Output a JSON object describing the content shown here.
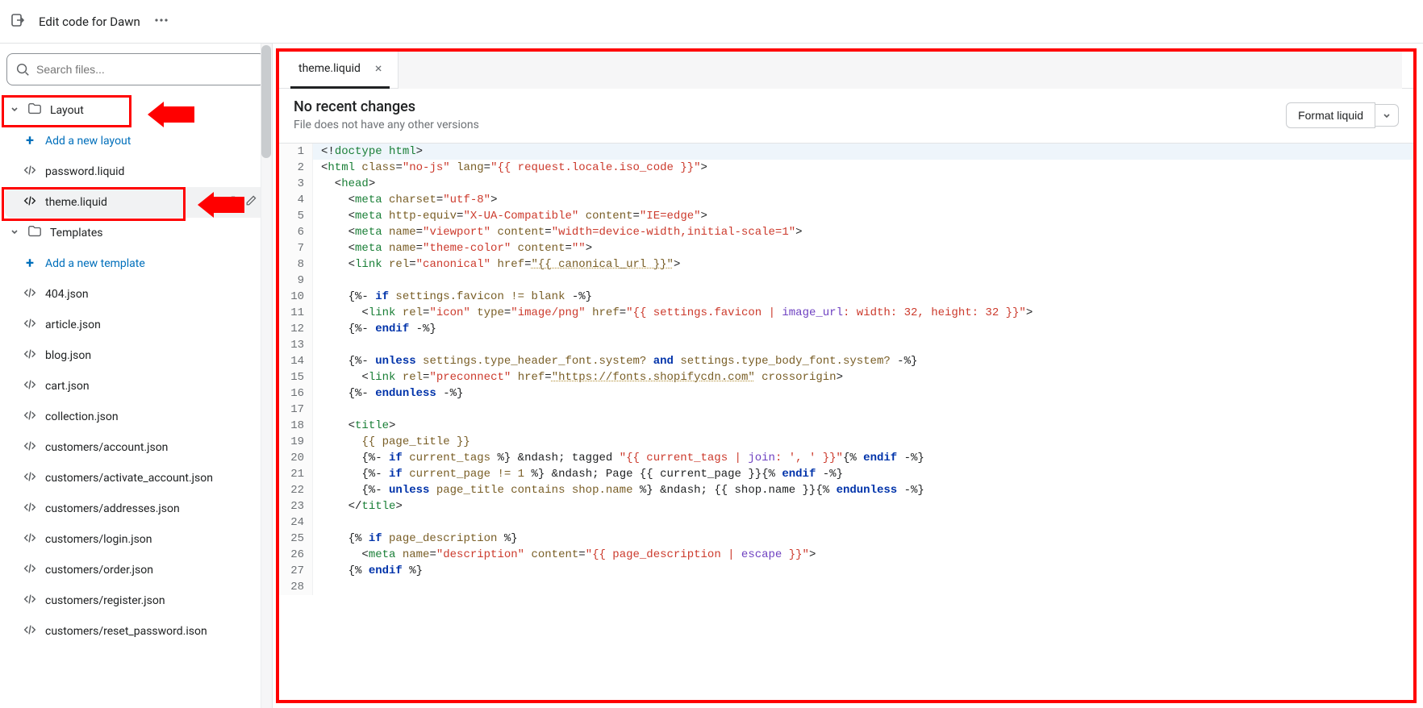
{
  "topbar": {
    "title": "Edit code for Dawn"
  },
  "sidebar": {
    "search_placeholder": "Search files...",
    "layout_folder": "Layout",
    "add_layout": "Add a new layout",
    "files_layout": [
      "password.liquid",
      "theme.liquid"
    ],
    "templates_folder": "Templates",
    "add_template": "Add a new template",
    "files_templates": [
      "404.json",
      "article.json",
      "blog.json",
      "cart.json",
      "collection.json",
      "customers/account.json",
      "customers/activate_account.json",
      "customers/addresses.json",
      "customers/login.json",
      "customers/order.json",
      "customers/register.json",
      "customers/reset_password.ison"
    ]
  },
  "editor": {
    "tab_name": "theme.liquid",
    "header_title": "No recent changes",
    "header_sub": "File does not have any other versions",
    "format_btn": "Format liquid"
  },
  "code_lines": [
    {
      "n": 1,
      "hl": true,
      "seg": [
        [
          "t-punc",
          "<!"
        ],
        [
          "t-tag",
          "doctype"
        ],
        [
          "t-punc",
          " "
        ],
        [
          "t-tag",
          "html"
        ],
        [
          "t-punc",
          ">"
        ]
      ]
    },
    {
      "n": 2,
      "seg": [
        [
          "t-punc",
          "<"
        ],
        [
          "t-tag",
          "html"
        ],
        [
          "t-punc",
          " "
        ],
        [
          "t-attr",
          "class"
        ],
        [
          "t-punc",
          "="
        ],
        [
          "t-str",
          "\"no-js\""
        ],
        [
          "t-punc",
          " "
        ],
        [
          "t-attr",
          "lang"
        ],
        [
          "t-punc",
          "="
        ],
        [
          "t-str",
          "\"{{ request.locale.iso_code }}\""
        ],
        [
          "t-punc",
          ">"
        ]
      ]
    },
    {
      "n": 3,
      "seg": [
        [
          "t-punc",
          "  <"
        ],
        [
          "t-tag",
          "head"
        ],
        [
          "t-punc",
          ">"
        ]
      ]
    },
    {
      "n": 4,
      "seg": [
        [
          "t-punc",
          "    <"
        ],
        [
          "t-tag",
          "meta"
        ],
        [
          "t-punc",
          " "
        ],
        [
          "t-attr",
          "charset"
        ],
        [
          "t-punc",
          "="
        ],
        [
          "t-str",
          "\"utf-8\""
        ],
        [
          "t-punc",
          ">"
        ]
      ]
    },
    {
      "n": 5,
      "seg": [
        [
          "t-punc",
          "    <"
        ],
        [
          "t-tag",
          "meta"
        ],
        [
          "t-punc",
          " "
        ],
        [
          "t-attr",
          "http-equiv"
        ],
        [
          "t-punc",
          "="
        ],
        [
          "t-str",
          "\"X-UA-Compatible\""
        ],
        [
          "t-punc",
          " "
        ],
        [
          "t-attr",
          "content"
        ],
        [
          "t-punc",
          "="
        ],
        [
          "t-str",
          "\"IE=edge\""
        ],
        [
          "t-punc",
          ">"
        ]
      ]
    },
    {
      "n": 6,
      "seg": [
        [
          "t-punc",
          "    <"
        ],
        [
          "t-tag",
          "meta"
        ],
        [
          "t-punc",
          " "
        ],
        [
          "t-attr",
          "name"
        ],
        [
          "t-punc",
          "="
        ],
        [
          "t-str",
          "\"viewport\""
        ],
        [
          "t-punc",
          " "
        ],
        [
          "t-attr",
          "content"
        ],
        [
          "t-punc",
          "="
        ],
        [
          "t-str",
          "\"width=device-width,initial-scale=1\""
        ],
        [
          "t-punc",
          ">"
        ]
      ]
    },
    {
      "n": 7,
      "seg": [
        [
          "t-punc",
          "    <"
        ],
        [
          "t-tag",
          "meta"
        ],
        [
          "t-punc",
          " "
        ],
        [
          "t-attr",
          "name"
        ],
        [
          "t-punc",
          "="
        ],
        [
          "t-str",
          "\"theme-color\""
        ],
        [
          "t-punc",
          " "
        ],
        [
          "t-attr",
          "content"
        ],
        [
          "t-punc",
          "="
        ],
        [
          "t-str",
          "\"\""
        ],
        [
          "t-punc",
          ">"
        ]
      ]
    },
    {
      "n": 8,
      "seg": [
        [
          "t-punc",
          "    <"
        ],
        [
          "t-tag",
          "link"
        ],
        [
          "t-punc",
          " "
        ],
        [
          "t-attr",
          "rel"
        ],
        [
          "t-punc",
          "="
        ],
        [
          "t-str",
          "\"canonical\""
        ],
        [
          "t-punc",
          " "
        ],
        [
          "t-attr",
          "href"
        ],
        [
          "t-punc",
          "="
        ],
        [
          "t-url",
          "\"{{ canonical_url }}\""
        ],
        [
          "t-punc",
          ">"
        ]
      ]
    },
    {
      "n": 9,
      "seg": [
        [
          "",
          ""
        ]
      ]
    },
    {
      "n": 10,
      "seg": [
        [
          "t-punc",
          "    {%- "
        ],
        [
          "t-kw",
          "if"
        ],
        [
          "t-liq",
          " settings.favicon != blank "
        ],
        [
          "t-punc",
          "-%}"
        ]
      ]
    },
    {
      "n": 11,
      "seg": [
        [
          "t-punc",
          "      <"
        ],
        [
          "t-tag",
          "link"
        ],
        [
          "t-punc",
          " "
        ],
        [
          "t-attr",
          "rel"
        ],
        [
          "t-punc",
          "="
        ],
        [
          "t-str",
          "\"icon\""
        ],
        [
          "t-punc",
          " "
        ],
        [
          "t-attr",
          "type"
        ],
        [
          "t-punc",
          "="
        ],
        [
          "t-str",
          "\"image/png\""
        ],
        [
          "t-punc",
          " "
        ],
        [
          "t-attr",
          "href"
        ],
        [
          "t-punc",
          "="
        ],
        [
          "t-str",
          "\"{{ settings.favicon | "
        ],
        [
          "t-filter",
          "image_url"
        ],
        [
          "t-str",
          ": width: 32, height: 32 }}\""
        ],
        [
          "t-punc",
          ">"
        ]
      ]
    },
    {
      "n": 12,
      "seg": [
        [
          "t-punc",
          "    {%- "
        ],
        [
          "t-kw",
          "endif"
        ],
        [
          "t-punc",
          " -%}"
        ]
      ]
    },
    {
      "n": 13,
      "seg": [
        [
          "",
          ""
        ]
      ]
    },
    {
      "n": 14,
      "seg": [
        [
          "t-punc",
          "    {%- "
        ],
        [
          "t-kw",
          "unless"
        ],
        [
          "t-liq",
          " settings.type_header_font.system? "
        ],
        [
          "t-kw",
          "and"
        ],
        [
          "t-liq",
          " settings.type_body_font.system? "
        ],
        [
          "t-punc",
          "-%}"
        ]
      ]
    },
    {
      "n": 15,
      "seg": [
        [
          "t-punc",
          "      <"
        ],
        [
          "t-tag",
          "link"
        ],
        [
          "t-punc",
          " "
        ],
        [
          "t-attr",
          "rel"
        ],
        [
          "t-punc",
          "="
        ],
        [
          "t-str",
          "\"preconnect\""
        ],
        [
          "t-punc",
          " "
        ],
        [
          "t-attr",
          "href"
        ],
        [
          "t-punc",
          "="
        ],
        [
          "t-url",
          "\"https://fonts.shopifycdn.com\""
        ],
        [
          "t-punc",
          " "
        ],
        [
          "t-attr",
          "crossorigin"
        ],
        [
          "t-punc",
          ">"
        ]
      ]
    },
    {
      "n": 16,
      "seg": [
        [
          "t-punc",
          "    {%- "
        ],
        [
          "t-kw",
          "endunless"
        ],
        [
          "t-punc",
          " -%}"
        ]
      ]
    },
    {
      "n": 17,
      "seg": [
        [
          "",
          ""
        ]
      ]
    },
    {
      "n": 18,
      "seg": [
        [
          "t-punc",
          "    <"
        ],
        [
          "t-tag",
          "title"
        ],
        [
          "t-punc",
          ">"
        ]
      ]
    },
    {
      "n": 19,
      "seg": [
        [
          "t-liq",
          "      {{ page_title }}"
        ]
      ]
    },
    {
      "n": 20,
      "seg": [
        [
          "t-punc",
          "      {%- "
        ],
        [
          "t-kw",
          "if"
        ],
        [
          "t-liq",
          " current_tags "
        ],
        [
          "t-punc",
          "%}"
        ],
        [
          "t-var",
          " &ndash; tagged "
        ],
        [
          "t-str",
          "\"{{ current_tags | "
        ],
        [
          "t-filter",
          "join"
        ],
        [
          "t-str",
          ": ', ' }}\""
        ],
        [
          "t-punc",
          "{% "
        ],
        [
          "t-kw",
          "endif"
        ],
        [
          "t-punc",
          " -%}"
        ]
      ]
    },
    {
      "n": 21,
      "seg": [
        [
          "t-punc",
          "      {%- "
        ],
        [
          "t-kw",
          "if"
        ],
        [
          "t-liq",
          " current_page != 1 "
        ],
        [
          "t-punc",
          "%}"
        ],
        [
          "t-var",
          " &ndash; Page {{ current_page }}"
        ],
        [
          "t-punc",
          "{% "
        ],
        [
          "t-kw",
          "endif"
        ],
        [
          "t-punc",
          " -%}"
        ]
      ]
    },
    {
      "n": 22,
      "seg": [
        [
          "t-punc",
          "      {%- "
        ],
        [
          "t-kw",
          "unless"
        ],
        [
          "t-liq",
          " page_title contains shop.name "
        ],
        [
          "t-punc",
          "%}"
        ],
        [
          "t-var",
          " &ndash; {{ shop.name }}"
        ],
        [
          "t-punc",
          "{% "
        ],
        [
          "t-kw",
          "endunless"
        ],
        [
          "t-punc",
          " -%}"
        ]
      ]
    },
    {
      "n": 23,
      "seg": [
        [
          "t-punc",
          "    </"
        ],
        [
          "t-tag",
          "title"
        ],
        [
          "t-punc",
          ">"
        ]
      ]
    },
    {
      "n": 24,
      "seg": [
        [
          "",
          ""
        ]
      ]
    },
    {
      "n": 25,
      "seg": [
        [
          "t-punc",
          "    {% "
        ],
        [
          "t-kw",
          "if"
        ],
        [
          "t-liq",
          " page_description "
        ],
        [
          "t-punc",
          "%}"
        ]
      ]
    },
    {
      "n": 26,
      "seg": [
        [
          "t-punc",
          "      <"
        ],
        [
          "t-tag",
          "meta"
        ],
        [
          "t-punc",
          " "
        ],
        [
          "t-attr",
          "name"
        ],
        [
          "t-punc",
          "="
        ],
        [
          "t-str",
          "\"description\""
        ],
        [
          "t-punc",
          " "
        ],
        [
          "t-attr",
          "content"
        ],
        [
          "t-punc",
          "="
        ],
        [
          "t-str",
          "\"{{ page_description | "
        ],
        [
          "t-filter",
          "escape"
        ],
        [
          "t-str",
          " }}\""
        ],
        [
          "t-punc",
          ">"
        ]
      ]
    },
    {
      "n": 27,
      "seg": [
        [
          "t-punc",
          "    {% "
        ],
        [
          "t-kw",
          "endif"
        ],
        [
          "t-punc",
          " %}"
        ]
      ]
    },
    {
      "n": 28,
      "seg": [
        [
          "",
          ""
        ]
      ]
    }
  ]
}
